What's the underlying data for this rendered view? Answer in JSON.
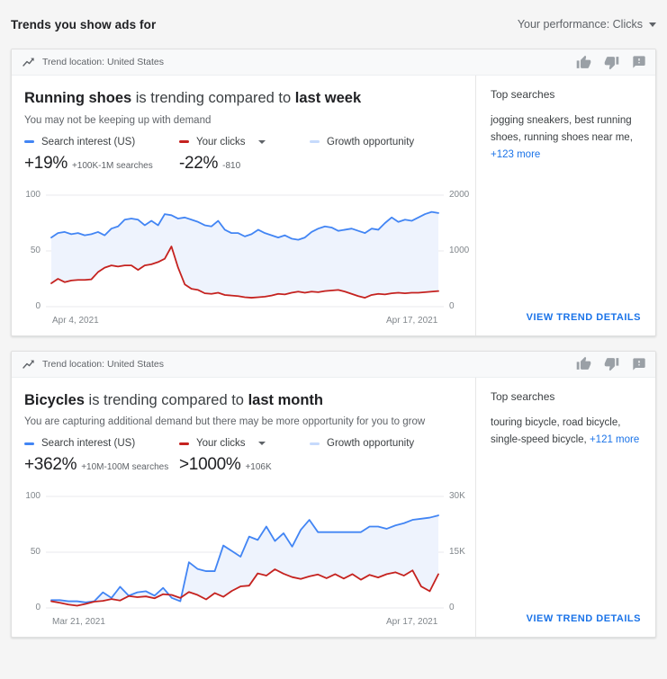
{
  "header": {
    "title": "Trends you show ads for",
    "performance_label": "Your performance: Clicks",
    "caret_icon": "chevron-down-icon"
  },
  "cards": [
    {
      "location_icon": "trend-up-icon",
      "location": "Trend location: United States",
      "actions": [
        {
          "icon": "thumb-up-icon"
        },
        {
          "icon": "thumb-down-icon"
        },
        {
          "icon": "feedback-icon"
        }
      ],
      "headline_term": "Running shoes",
      "headline_mid": " is trending compared to ",
      "headline_period": "last week",
      "subline": "You may not be keeping up with demand",
      "legend": {
        "search_interest": "Search interest (US)",
        "search_interest_color": "#4285f4",
        "your_clicks": "Your clicks",
        "your_clicks_color": "#c5221f",
        "growth_opportunity": "Growth opportunity",
        "growth_opportunity_color": "#c6dafc"
      },
      "metrics": {
        "search_interest_value": "+19%",
        "search_interest_sub": "+100K-1M searches",
        "clicks_value": "-22%",
        "clicks_sub": "-810"
      },
      "top_searches_title": "Top searches",
      "top_searches_text": "jogging sneakers, best running shoes, running shoes near me, ",
      "top_searches_more": "+123 more",
      "view_details": "VIEW TREND DETAILS",
      "chart_data": {
        "type": "line",
        "title": "Running shoes search interest vs your clicks",
        "xlabel": "",
        "ylabel": "",
        "x_start_label": "Apr 4, 2021",
        "x_end_label": "Apr 17, 2021",
        "left_axis_ticks": [
          "0",
          "50",
          "100"
        ],
        "right_axis_ticks": [
          "0",
          "1000",
          "2000"
        ],
        "ylim_left": [
          0,
          100
        ],
        "ylim_right": [
          0,
          2000
        ],
        "grid": true,
        "legend_position": "above-chart",
        "series": [
          {
            "name": "Search interest (US)",
            "axis": "left",
            "color": "#4285f4",
            "values": [
              62,
              66,
              67,
              65,
              66,
              64,
              65,
              67,
              64,
              70,
              72,
              78,
              79,
              78,
              73,
              77,
              73,
              83,
              82,
              79,
              80,
              78,
              76,
              73,
              72,
              77,
              69,
              66,
              66,
              63,
              65,
              69,
              66,
              64,
              62,
              64,
              61,
              60,
              62,
              67,
              70,
              72,
              71,
              68,
              69,
              70,
              68,
              66,
              70,
              69,
              75,
              80,
              76,
              78,
              77,
              80,
              83,
              85,
              84
            ]
          },
          {
            "name": "Your clicks",
            "axis": "right",
            "color": "#c5221f",
            "values": [
              420,
              500,
              440,
              470,
              480,
              480,
              490,
              620,
              700,
              740,
              720,
              740,
              740,
              660,
              740,
              760,
              800,
              860,
              1080,
              700,
              400,
              320,
              300,
              240,
              230,
              250,
              210,
              200,
              190,
              170,
              160,
              170,
              180,
              200,
              230,
              220,
              250,
              270,
              250,
              270,
              260,
              280,
              290,
              300,
              270,
              230,
              190,
              160,
              210,
              230,
              220,
              240,
              250,
              240,
              250,
              250,
              260,
              270,
              280
            ]
          }
        ]
      }
    },
    {
      "location_icon": "trend-up-icon",
      "location": "Trend location: United States",
      "actions": [
        {
          "icon": "thumb-up-icon"
        },
        {
          "icon": "thumb-down-icon"
        },
        {
          "icon": "feedback-icon"
        }
      ],
      "headline_term": "Bicycles",
      "headline_mid": " is trending compared to ",
      "headline_period": "last month",
      "subline": "You are capturing additional demand but there may be more opportunity for you to grow",
      "legend": {
        "search_interest": "Search interest (US)",
        "search_interest_color": "#4285f4",
        "your_clicks": "Your clicks",
        "your_clicks_color": "#c5221f",
        "growth_opportunity": "Growth opportunity",
        "growth_opportunity_color": "#c6dafc"
      },
      "metrics": {
        "search_interest_value": "+362%",
        "search_interest_sub": "+10M-100M searches",
        "clicks_value": ">1000%",
        "clicks_sub": "+106K"
      },
      "top_searches_title": "Top searches",
      "top_searches_text": "touring bicycle, road bicycle, single-speed bicycle, ",
      "top_searches_more": "+121 more",
      "view_details": "VIEW TREND DETAILS",
      "chart_data": {
        "type": "line",
        "title": "Bicycles search interest vs your clicks",
        "xlabel": "",
        "ylabel": "",
        "x_start_label": "Mar 21, 2021",
        "x_end_label": "Apr 17, 2021",
        "left_axis_ticks": [
          "0",
          "50",
          "100"
        ],
        "right_axis_ticks": [
          "0",
          "15K",
          "30K"
        ],
        "ylim_left": [
          0,
          100
        ],
        "ylim_right": [
          0,
          30000
        ],
        "grid": true,
        "legend_position": "above-chart",
        "series": [
          {
            "name": "Search interest (US)",
            "axis": "left",
            "color": "#4285f4",
            "values": [
              7,
              7,
              6,
              6,
              5,
              6,
              14,
              9,
              19,
              11,
              14,
              15,
              11,
              18,
              9,
              6,
              41,
              35,
              33,
              33,
              56,
              51,
              46,
              64,
              61,
              73,
              60,
              67,
              55,
              70,
              79,
              68,
              68,
              68,
              68,
              68,
              68,
              73,
              73,
              71,
              74,
              76,
              79,
              80,
              81,
              83
            ]
          },
          {
            "name": "Your clicks",
            "axis": "right",
            "color": "#c5221f",
            "values": [
              1800,
              1400,
              900,
              600,
              1100,
              1700,
              1900,
              2400,
              2000,
              3200,
              2900,
              3100,
              2600,
              3700,
              3500,
              2700,
              4300,
              3500,
              2300,
              4000,
              3000,
              4600,
              5800,
              6000,
              9300,
              8700,
              10400,
              9200,
              8300,
              7800,
              8500,
              9000,
              8000,
              9100,
              7900,
              9100,
              7600,
              8900,
              8200,
              9100,
              9600,
              8700,
              10100,
              5800,
              4500,
              9100
            ]
          }
        ]
      }
    }
  ]
}
